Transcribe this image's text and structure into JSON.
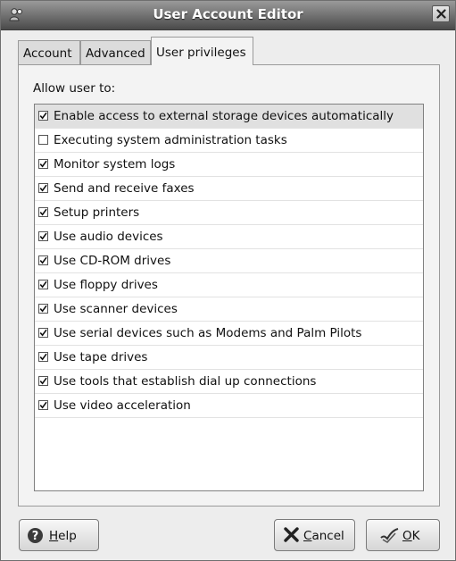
{
  "window": {
    "title": "User Account Editor"
  },
  "tabs": [
    {
      "label": "Account",
      "active": false
    },
    {
      "label": "Advanced",
      "active": false
    },
    {
      "label": "User privileges",
      "active": true
    }
  ],
  "panel": {
    "allow_label": "Allow user to:",
    "privileges": [
      {
        "label": "Enable access to external storage devices automatically",
        "checked": true,
        "selected": true
      },
      {
        "label": "Executing system administration tasks",
        "checked": false
      },
      {
        "label": "Monitor system logs",
        "checked": true
      },
      {
        "label": "Send and receive faxes",
        "checked": true
      },
      {
        "label": "Setup printers",
        "checked": true
      },
      {
        "label": "Use audio devices",
        "checked": true
      },
      {
        "label": "Use CD-ROM drives",
        "checked": true
      },
      {
        "label": "Use floppy drives",
        "checked": true
      },
      {
        "label": "Use scanner devices",
        "checked": true
      },
      {
        "label": "Use serial devices such as Modems and Palm Pilots",
        "checked": true
      },
      {
        "label": "Use tape drives",
        "checked": true
      },
      {
        "label": "Use tools that establish dial up connections",
        "checked": true
      },
      {
        "label": "Use video acceleration",
        "checked": true
      }
    ]
  },
  "buttons": {
    "help": "Help",
    "cancel": "Cancel",
    "ok": "OK"
  },
  "icons": {
    "window": "user-icon",
    "close": "close-icon",
    "help": "help-icon",
    "cancel": "cancel-icon",
    "ok": "ok-icon"
  }
}
